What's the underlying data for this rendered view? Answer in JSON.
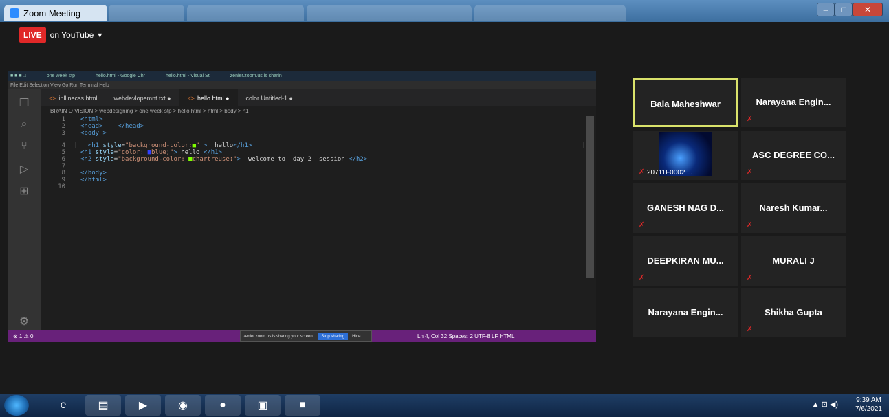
{
  "window": {
    "title": "Zoom Meeting"
  },
  "live": {
    "badge": "LIVE",
    "platform": "on YouTube"
  },
  "vscode": {
    "menu": "File Edit Selection View Go Run Terminal Help",
    "tabs": [
      {
        "label": "inllinecss.html"
      },
      {
        "label": "webdevlopemnt.txt ●"
      },
      {
        "label": "hello.html ●"
      },
      {
        "label": "color Untitled-1 ●"
      }
    ],
    "breadcrumb": "BRAIN O VISION > webdesigning > one week stp > hello.html > html > body > h1",
    "lines": [
      "1",
      "2",
      "3",
      "4",
      "5",
      "6",
      "7",
      "8",
      "9",
      "10"
    ],
    "status_left": "⊗ 1 ⚠ 0",
    "status_right": "Ln 4, Col 32   Spaces: 2   UTF-8   LF   HTML",
    "share_notice": "zenler.zoom.us is sharing your screen.",
    "stop_sharing": "Stop sharing",
    "hide": "Hide"
  },
  "participants": [
    {
      "name": "Bala Maheshwar",
      "muted": false,
      "selected": true
    },
    {
      "name": "Narayana Engin...",
      "muted": true
    },
    {
      "name": "20711F0002 ...",
      "muted": true,
      "video": true
    },
    {
      "name": "ASC DEGREE CO...",
      "muted": true
    },
    {
      "name": "GANESH NAG D...",
      "muted": true
    },
    {
      "name": "Naresh Kumar...",
      "muted": true
    },
    {
      "name": "DEEPKIRAN MU...",
      "muted": true
    },
    {
      "name": "MURALI J",
      "muted": true
    },
    {
      "name": "Narayana Engin...",
      "muted": false
    },
    {
      "name": "Shikha Gupta",
      "muted": true
    }
  ],
  "taskbar": {
    "time": "9:39 AM",
    "date": "7/6/2021"
  }
}
